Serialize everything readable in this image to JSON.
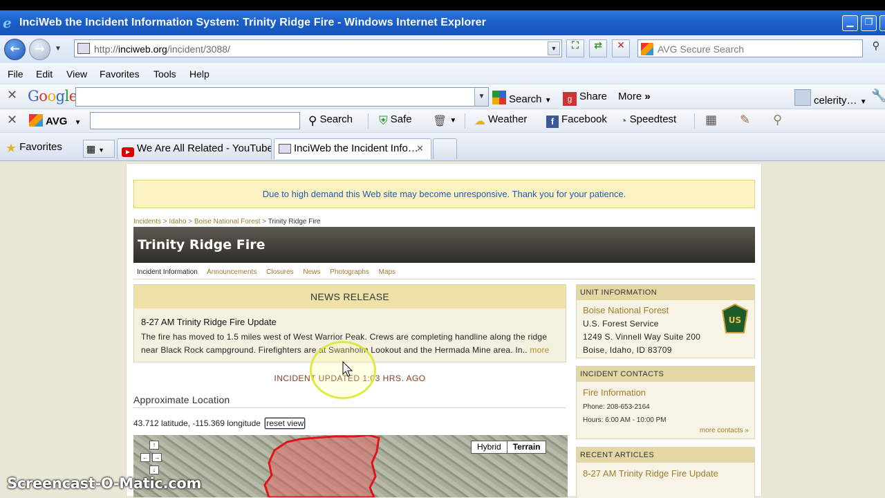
{
  "window": {
    "title": "InciWeb the Incident Information System: Trinity Ridge Fire - Windows Internet Explorer",
    "controls": [
      "minimize",
      "restore",
      "close"
    ]
  },
  "address": {
    "url_prefix": "http://",
    "url_host": "inciweb.org",
    "url_path": "/incident/3088/",
    "search_placeholder": "AVG Secure Search"
  },
  "menu": [
    "File",
    "Edit",
    "View",
    "Favorites",
    "Tools",
    "Help"
  ],
  "google_toolbar": {
    "logo": "Google",
    "search_label": "Search",
    "share_label": "Share",
    "more_label": "More",
    "more_arrows": "»",
    "account": "celerity…"
  },
  "avg_toolbar": {
    "logo": "AVG",
    "search_label": "Search",
    "safe_label": "Safe",
    "weather_label": "Weather",
    "facebook_label": "Facebook",
    "speedtest_label": "Speedtest"
  },
  "tabs_bar": {
    "favorites_label": "Favorites",
    "tabs": [
      {
        "label": "We Are All Related - YouTube",
        "active": false
      },
      {
        "label": "InciWeb the Incident Info…",
        "active": true
      }
    ]
  },
  "page": {
    "notice": "Due to high demand this Web site may become unresponsive. Thank you for your patience.",
    "breadcrumbs": [
      "Incidents",
      "Idaho",
      "Boise National Forest",
      "Trinity Ridge Fire"
    ],
    "breadcrumb_sep": ">",
    "fire_name": "Trinity Ridge Fire",
    "subnav": [
      "Incident Information",
      "Announcements",
      "Closures",
      "News",
      "Photographs",
      "Maps"
    ],
    "news_release": {
      "heading": "NEWS RELEASE",
      "title": "8-27 AM Trinity Ridge Fire Update",
      "body": "The fire has moved to 1.5 miles west of West Warrior Peak. Crews are completing handline along the ridge near Black Rock campground. Firefighters are at Swanholm Lookout and the Hermada Mine area. In..",
      "more": "more"
    },
    "updated": "INCIDENT UPDATED 1:03 HRS. AGO",
    "approximate_location": {
      "heading": "Approximate Location",
      "coords": "43.712 latitude, -115.369 longitude",
      "reset_view": "reset view"
    },
    "map": {
      "type_hybrid": "Hybrid",
      "type_terrain": "Terrain",
      "selected": "Terrain"
    },
    "unit_information": {
      "heading": "UNIT INFORMATION",
      "name": "Boise National Forest",
      "line1": "U.S. Forest Service",
      "line2": "1249 S. Vinnell Way Suite 200",
      "line3": "Boise, Idaho, ID 83709",
      "badge_text": "US"
    },
    "incident_contacts": {
      "heading": "INCIDENT CONTACTS",
      "name": "Fire Information",
      "phone": "Phone: 208-653-2164",
      "hours": "Hours: 6:00 AM - 10:00 PM",
      "more": "more contacts »"
    },
    "recent_articles": {
      "heading": "RECENT ARTICLES",
      "items": [
        "8-27 AM Trinity Ridge Fire Update"
      ]
    }
  },
  "watermark": "Screencast-O-Matic.com",
  "colors": {
    "titlebar": "#1b5fc9",
    "link_gold": "#a07b2a",
    "notice_bg": "#fcf2c2",
    "fire_perimeter": "#e0131b",
    "header_dark": "#2e2c27"
  }
}
